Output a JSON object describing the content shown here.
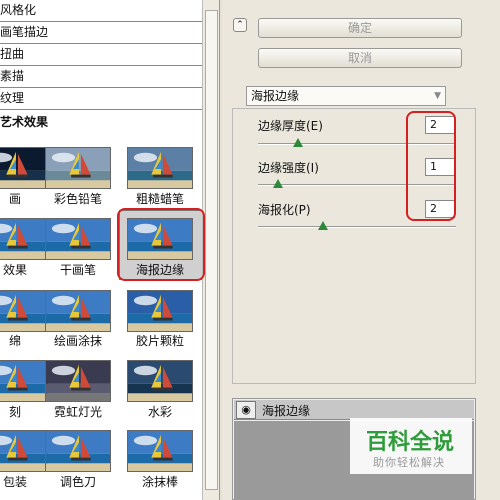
{
  "left_panel": {
    "categories": [
      "风格化",
      "画笔描边",
      "扭曲",
      "素描",
      "纹理",
      "艺术效果"
    ],
    "filters": [
      {
        "label": "画",
        "style": "dark"
      },
      {
        "label": "彩色铅笔",
        "style": "pencil"
      },
      {
        "label": "粗糙蜡笔",
        "style": "rough"
      },
      {
        "label": "效果",
        "style": "boat"
      },
      {
        "label": "干画笔",
        "style": "boat"
      },
      {
        "label": "海报边缘",
        "style": "boat-poster"
      },
      {
        "label": "绵",
        "style": "boat"
      },
      {
        "label": "绘画涂抹",
        "style": "boat"
      },
      {
        "label": "胶片颗粒",
        "style": "grain"
      },
      {
        "label": "刻",
        "style": "boat"
      },
      {
        "label": "霓虹灯光",
        "style": "neon"
      },
      {
        "label": "水彩",
        "style": "boat-dark"
      },
      {
        "label": "包装",
        "style": "boat"
      },
      {
        "label": "调色刀",
        "style": "boat"
      },
      {
        "label": "涂抹棒",
        "style": "boat"
      }
    ]
  },
  "right_panel": {
    "ok_label": "确定",
    "cancel_label": "取消",
    "filter_select": "海报边缘",
    "params": [
      {
        "label": "边缘厚度(E)",
        "value": "2",
        "level": 0.2
      },
      {
        "label": "边缘强度(I)",
        "value": "1",
        "level": 0.1
      },
      {
        "label": "海报化(P)",
        "value": "2",
        "level": 0.33
      }
    ],
    "layer_name": "海报边缘"
  },
  "watermark": {
    "main": "百科全说",
    "sub": "助你轻松解决"
  },
  "colors": {
    "highlight": "#d42020",
    "slider_handle": "#2b8a3a",
    "watermark": "#2e9c3a"
  }
}
